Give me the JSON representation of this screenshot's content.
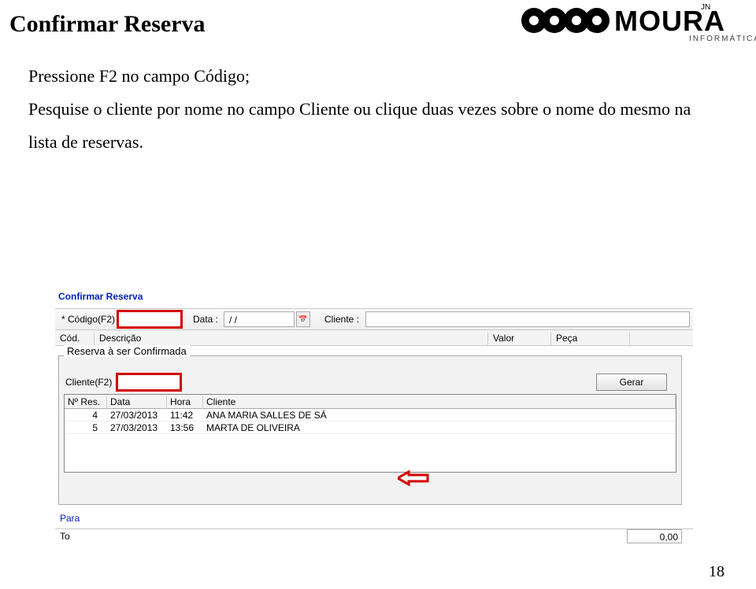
{
  "logo": {
    "brand": "MOURA",
    "jn": "JN",
    "sub": "INFORMÁTICA"
  },
  "title": "Confirmar Reserva",
  "bullets": {
    "item1": "Pressione F2 no campo Código;",
    "item2": "Pesquise o cliente por nome no campo Cliente ou clique duas vezes sobre o nome do mesmo na lista de reservas."
  },
  "ui": {
    "frame_title": "Confirmar Reserva",
    "codigo_label": "* Código(F2)",
    "data_label": "Data :",
    "data_value": "  /  /",
    "cliente_label": "Cliente :",
    "headers": {
      "cod": "Cód.",
      "desc": "Descrição",
      "valor": "Valor",
      "peca": "Peça"
    },
    "inner_title": "Reserva à ser Confirmada",
    "clientef2_label": "Cliente(F2)",
    "gerar": "Gerar",
    "res_headers": {
      "nres": "Nº Res.",
      "data": "Data",
      "hora": "Hora",
      "cli": "Cliente"
    },
    "rows": [
      {
        "nres": "4",
        "data": "27/03/2013",
        "hora": "11:42",
        "cli": "ANA MARIA SALLES DE SÁ"
      },
      {
        "nres": "5",
        "data": "27/03/2013",
        "hora": "13:56",
        "cli": "MARTA DE OLIVEIRA"
      }
    ],
    "para": "Para",
    "to": "To",
    "total_value": "0,00"
  },
  "page_number": "18"
}
